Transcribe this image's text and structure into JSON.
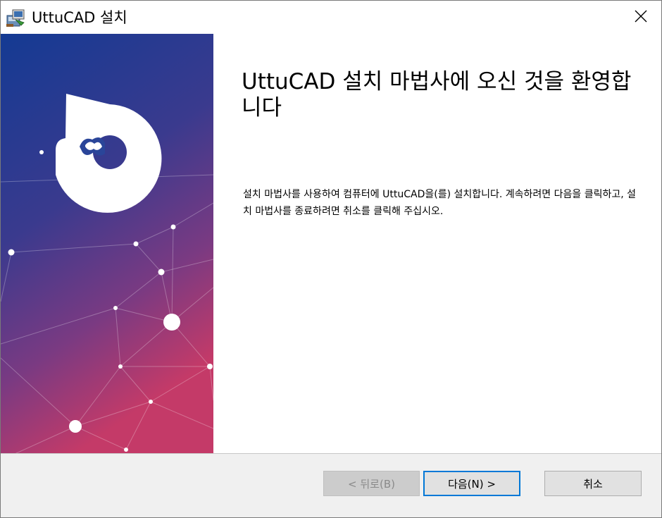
{
  "window": {
    "title": "UttuCAD 설치"
  },
  "icons": {
    "title": "installer-package-icon",
    "close": "close-icon",
    "logo": "puzzle-logo-icon"
  },
  "colors": {
    "banner_top": "#1a3a8f",
    "banner_bottom": "#c23a6a",
    "focus_border": "#0078d7",
    "footer_bg": "#f0f0f0"
  },
  "main": {
    "heading": "UttuCAD 설치 마법사에 오신 것을 환영합니다",
    "description": "설치 마법사를 사용하여 컴퓨터에 UttuCAD을(를) 설치합니다. 계속하려면 다음을 클릭하고, 설치 마법사를 종료하려면 취소를 클릭해 주십시오."
  },
  "buttons": {
    "back": "< 뒤로(B)",
    "next": "다음(N) >",
    "cancel": "취소"
  }
}
